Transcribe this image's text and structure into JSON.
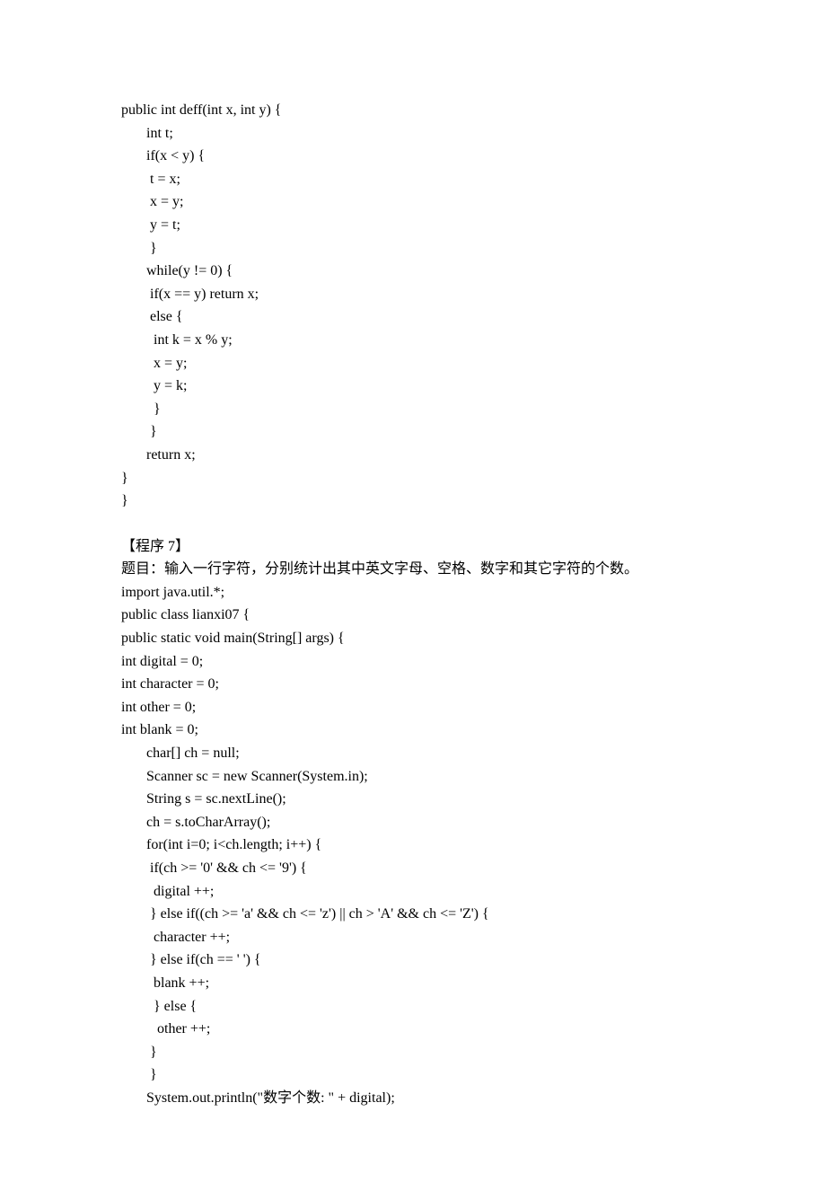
{
  "block1": {
    "lines": [
      "public int deff(int x, int y) {",
      "       int t;",
      "       if(x < y) {",
      "        t = x;",
      "        x = y;",
      "        y = t;",
      "        }",
      "       while(y != 0) {",
      "        if(x == y) return x;",
      "        else {",
      "         int k = x % y;",
      "         x = y;",
      "         y = k;",
      "         }",
      "        }",
      "       return x;",
      "}",
      "}"
    ]
  },
  "block2": {
    "title": "【程序 7】",
    "description": "题目：输入一行字符，分别统计出其中英文字母、空格、数字和其它字符的个数。",
    "lines": [
      "import java.util.*;",
      "public class lianxi07 {",
      "public static void main(String[] args) {",
      "int digital = 0;",
      "int character = 0;",
      "int other = 0;",
      "int blank = 0;",
      "       char[] ch = null;",
      "       Scanner sc = new Scanner(System.in);",
      "       String s = sc.nextLine();",
      "       ch = s.toCharArray();",
      "       for(int i=0; i<ch.length; i++) {",
      "        if(ch >= '0' && ch <= '9') {",
      "         digital ++;",
      "        } else if((ch >= 'a' && ch <= 'z') || ch > 'A' && ch <= 'Z') {",
      "         character ++;",
      "        } else if(ch == ' ') {",
      "         blank ++;",
      "         } else {",
      "          other ++;",
      "        }",
      "        }"
    ],
    "printlnPrefix": "       System.out.println(\"",
    "printlnCn": "数字个数",
    "printlnSuffix": ": \" + digital);"
  }
}
